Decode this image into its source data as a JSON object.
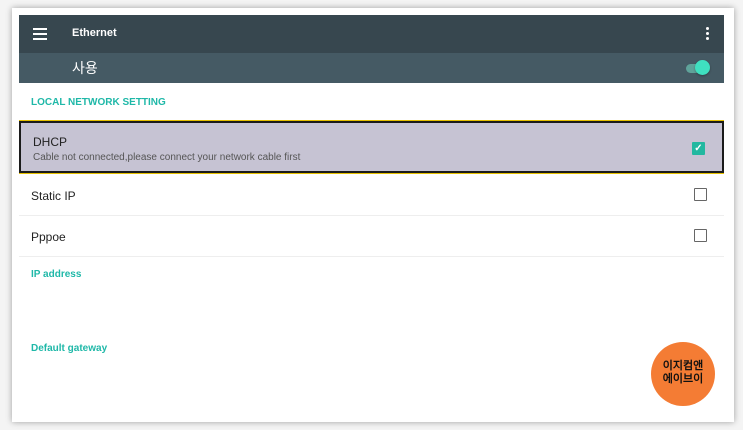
{
  "toolbar": {
    "title": "Ethernet",
    "menu_icon": "menu-icon",
    "more_icon": "more-vert-icon"
  },
  "enable": {
    "label": "사용",
    "state": true
  },
  "sections": {
    "local_network": "LOCAL NETWORK SETTING",
    "ip_address": "IP address",
    "gateway": "Default gateway"
  },
  "options": [
    {
      "label": "DHCP",
      "subtitle": "Cable not connected,please connect your network cable first",
      "checked": true
    },
    {
      "label": "Static IP",
      "checked": false
    },
    {
      "label": "Pppoe",
      "checked": false
    }
  ],
  "watermark": {
    "line1": "이지컴앤",
    "line2": "에이브이"
  },
  "colors": {
    "toolbar": "#37474f",
    "switchbar": "#455a64",
    "accent": "#1fb8a8",
    "selected_row": "#c6c3d3",
    "badge": "#f47c34"
  }
}
